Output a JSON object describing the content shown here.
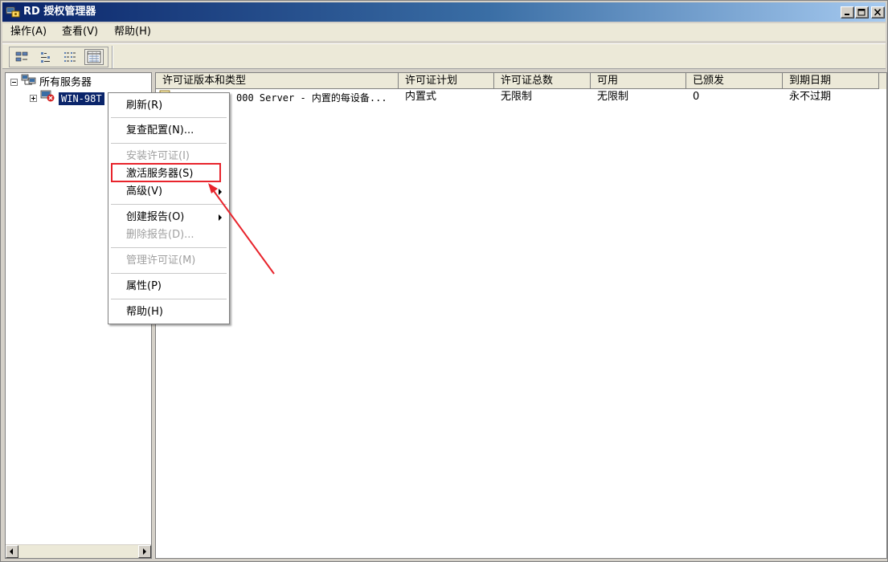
{
  "window": {
    "title": "RD 授权管理器",
    "controls": [
      "minimize",
      "maximize",
      "close"
    ]
  },
  "menubar": {
    "items": [
      {
        "label": "操作(A)"
      },
      {
        "label": "查看(V)"
      },
      {
        "label": "帮助(H)"
      }
    ]
  },
  "toolbar": {
    "buttons": [
      "view-large-icons",
      "view-small-icons",
      "view-list",
      "view-details"
    ],
    "active": "view-details"
  },
  "tree": {
    "root_label": "所有服务器",
    "server_label": "WIN-98T"
  },
  "list": {
    "columns": [
      "许可证版本和类型",
      "许可证计划",
      "许可证总数",
      "可用",
      "已颁发",
      "到期日期"
    ],
    "rows": [
      {
        "type": "Windows 2000 Server - 内置的每设备...",
        "type_visible": "000 Server - 内置的每设备...",
        "plan": "内置式",
        "total": "无限制",
        "available": "无限制",
        "issued": "0",
        "expiry": "永不过期"
      }
    ]
  },
  "context_menu": {
    "refresh": "刷新(R)",
    "review_config": "复查配置(N)...",
    "install_license": "安装许可证(I)",
    "activate_server": "激活服务器(S)",
    "advanced": "高级(V)",
    "create_report": "创建报告(O)",
    "delete_report": "删除报告(D)...",
    "manage_licenses": "管理许可证(M)",
    "properties": "属性(P)",
    "help": "帮助(H)"
  },
  "colors": {
    "title_gradient_start": "#0a246a",
    "title_gradient_end": "#a6caf0",
    "highlight_red": "#e8242c",
    "selection_blue": "#0a246a"
  }
}
